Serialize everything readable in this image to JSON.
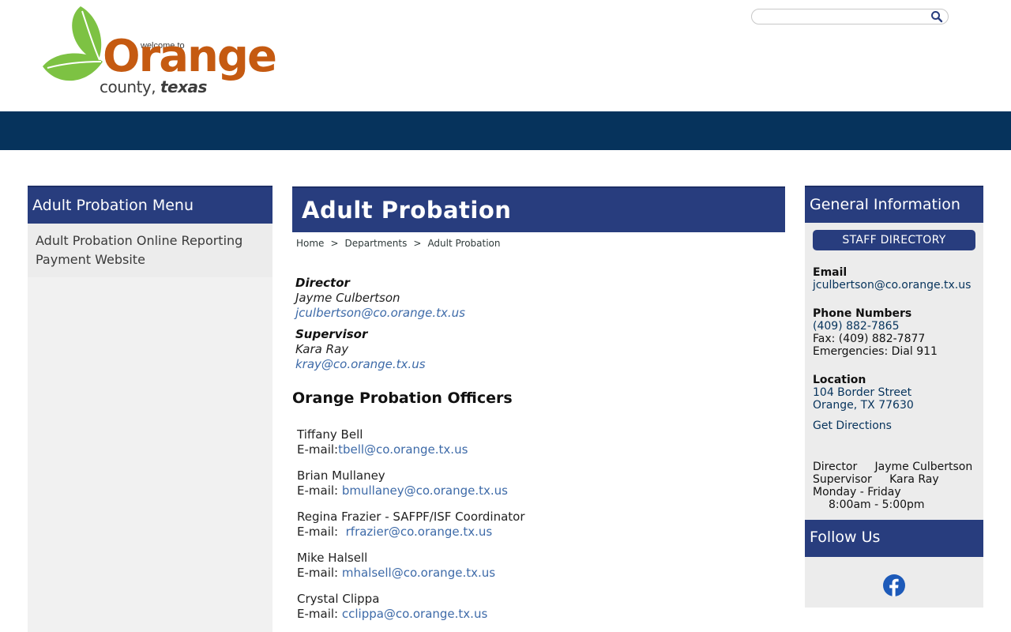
{
  "header": {
    "logo": {
      "welcome": "welcome to",
      "name": "Orange",
      "county": "county,",
      "state": "texas"
    },
    "search": {
      "placeholder": ""
    }
  },
  "left_menu": {
    "title": "Adult Probation Menu",
    "items": [
      {
        "label": "Adult Probation Online Reporting Payment Website"
      }
    ]
  },
  "main": {
    "title": "Adult Probation",
    "breadcrumb": [
      "Home",
      "Departments",
      "Adult Probation"
    ],
    "breadcrumb_sep": ">",
    "director": {
      "role": "Director",
      "name": "Jayme Culbertson",
      "email": "jculbertson@co.orange.tx.us"
    },
    "supervisor": {
      "role": "Supervisor",
      "name": "Kara Ray",
      "email": "kray@co.orange.tx.us"
    },
    "officers_title": "Orange Probation Officers",
    "officers": [
      {
        "name": "Tiffany Bell",
        "prefix": "E-mail:",
        "email": "tbell@co.orange.tx.us"
      },
      {
        "name": "Brian Mullaney",
        "prefix": "E-mail: ",
        "email": "bmullaney@co.orange.tx.us"
      },
      {
        "name": "Regina Frazier - SAFPF/ISF Coordinator",
        "prefix": "E-mail:  ",
        "email": "rfrazier@co.orange.tx.us"
      },
      {
        "name": "Mike Halsell",
        "prefix": "E-mail: ",
        "email": "mhalsell@co.orange.tx.us"
      },
      {
        "name": "Crystal Clippa",
        "prefix": "E-mail: ",
        "email": "cclippa@co.orange.tx.us"
      }
    ]
  },
  "right": {
    "title": "General Information",
    "staff_button": "STAFF DIRECTORY",
    "email_label": "Email",
    "email": "jculbertson@co.orange.tx.us",
    "phone_label": "Phone Numbers",
    "phone": "(409) 882-7865",
    "fax": "Fax: (409) 882-7877",
    "emergency": "Emergencies: Dial 911",
    "location_label": "Location",
    "street": "104 Border Street",
    "city": "Orange, TX 77630",
    "directions": "Get Directions",
    "director_label": "Director",
    "director_name": "Jayme Culbertson",
    "supervisor_label": "Supervisor",
    "supervisor_name": "Kara Ray",
    "days": "Monday - Friday",
    "hours": "8:00am - 5:00pm",
    "follow_title": "Follow Us"
  },
  "colors": {
    "navy": "#06335c",
    "header_blue": "#283d7e",
    "link_blue": "#3d6aa8",
    "brand_orange": "#c55a11",
    "leaf_green": "#7dc243"
  },
  "icons": [
    "search-icon",
    "facebook-icon",
    "leaf-logo-icon"
  ]
}
